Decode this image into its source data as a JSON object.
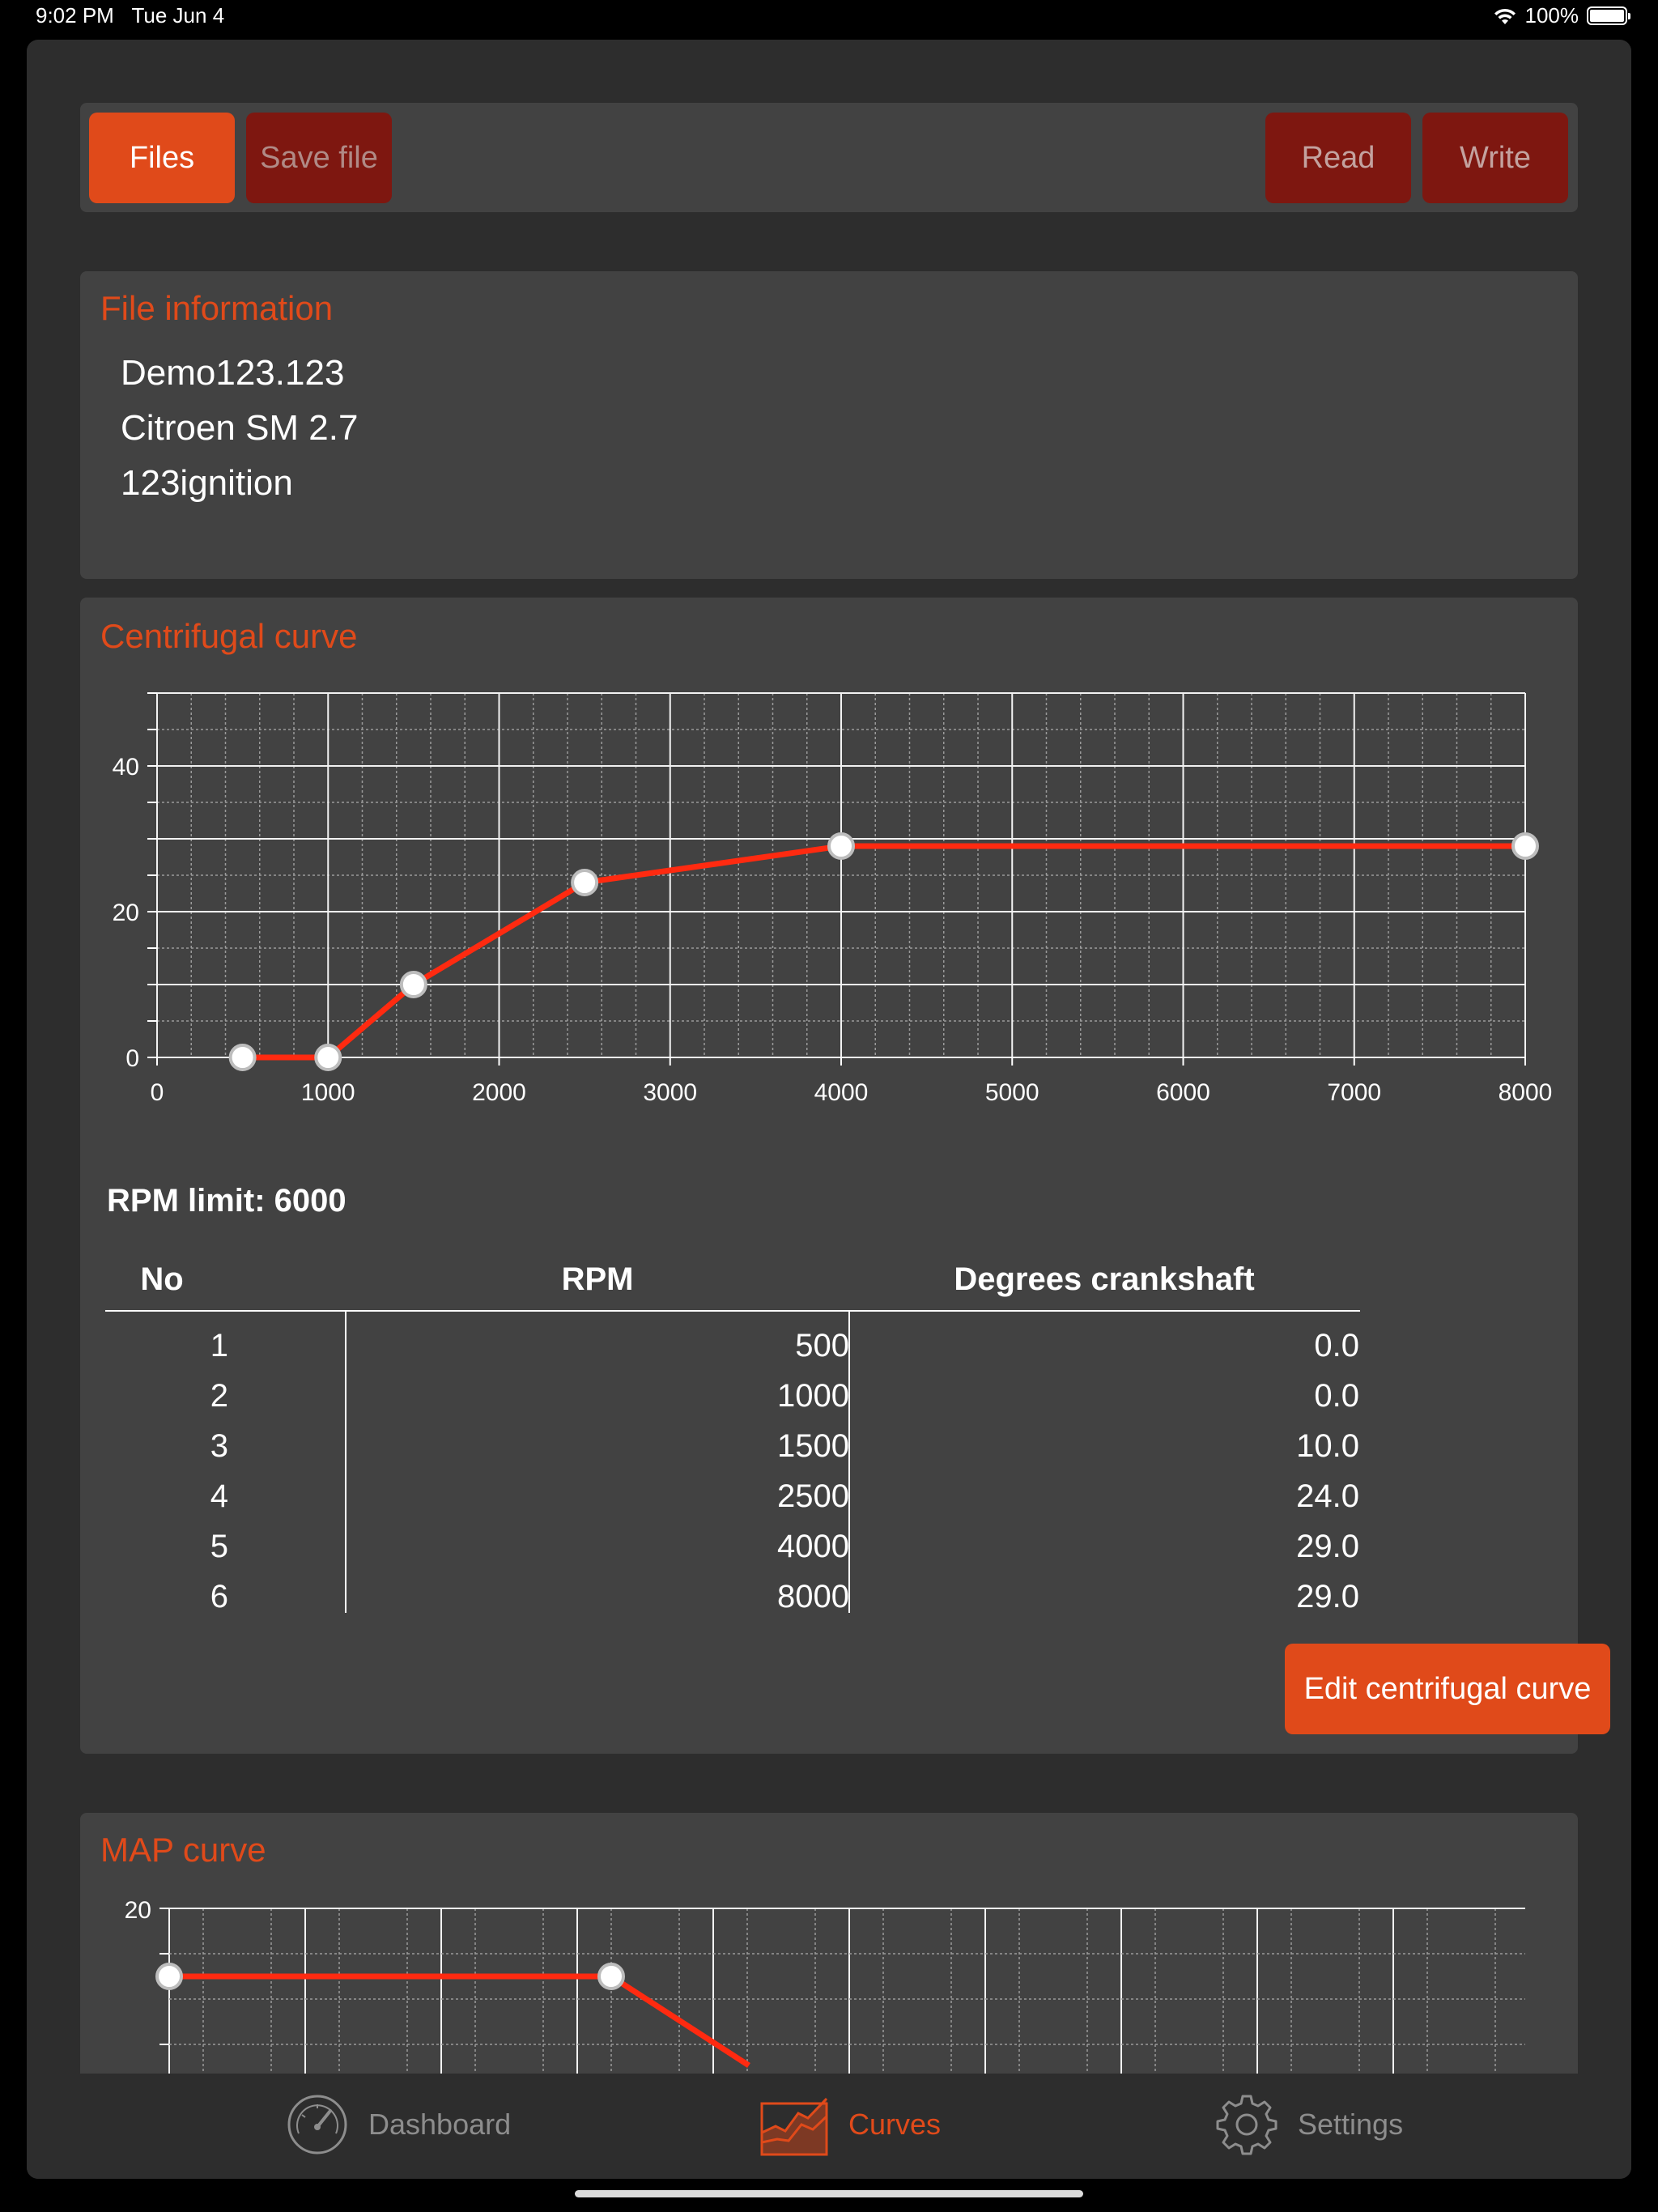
{
  "status_bar": {
    "time": "9:02 PM",
    "date": "Tue Jun 4",
    "battery": "100%"
  },
  "toolbar": {
    "files_label": "Files",
    "save_label": "Save file",
    "read_label": "Read",
    "write_label": "Write"
  },
  "file_info": {
    "title": "File information",
    "lines": [
      "Demo123.123",
      "Citroen SM 2.7",
      "123ignition"
    ]
  },
  "centrifugal": {
    "title": "Centrifugal curve",
    "rpm_limit": "RPM limit: 6000",
    "edit_label": "Edit centrifugal curve",
    "columns": [
      "No",
      "RPM",
      "Degrees crankshaft"
    ],
    "rows": [
      [
        "1",
        "500",
        "0.0"
      ],
      [
        "2",
        "1000",
        "0.0"
      ],
      [
        "3",
        "1500",
        "10.0"
      ],
      [
        "4",
        "2500",
        "24.0"
      ],
      [
        "5",
        "4000",
        "29.0"
      ],
      [
        "6",
        "8000",
        "29.0"
      ]
    ]
  },
  "map": {
    "title": "MAP curve",
    "y_tick_top": "20"
  },
  "tabs": {
    "dashboard": "Dashboard",
    "curves": "Curves",
    "settings": "Settings"
  },
  "colors": {
    "accent": "#e04a1a",
    "dark_button": "#7e1710",
    "line": "#ff2a10",
    "panel": "#424242",
    "background": "#2d2d2d"
  },
  "chart_data": [
    {
      "type": "line",
      "x": [
        500,
        1000,
        1500,
        2500,
        4000,
        8000
      ],
      "y": [
        0,
        0,
        10,
        24,
        29,
        29
      ],
      "xlim": [
        0,
        8000
      ],
      "ylim": [
        0,
        50
      ],
      "x_ticks": [
        "0",
        "1000",
        "2000",
        "3000",
        "4000",
        "5000",
        "6000",
        "7000",
        "8000"
      ],
      "y_ticks": [
        "0",
        "20",
        "40"
      ],
      "grid": true
    },
    {
      "type": "line",
      "x": [
        0,
        13
      ],
      "y": [
        14,
        14
      ],
      "y_ticks": [
        "20"
      ],
      "grid": true,
      "partially_visible": true
    }
  ]
}
